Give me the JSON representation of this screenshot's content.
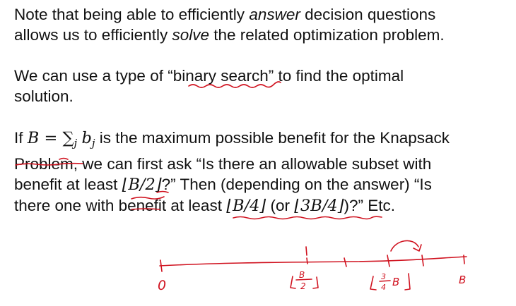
{
  "paragraph1": {
    "line1_a": "Note that being able to efficiently ",
    "line1_em": "answer",
    "line1_b": " decision questions",
    "line2_a": "allows us to efficiently ",
    "line2_em": "solve",
    "line2_b": " the related optimization problem."
  },
  "paragraph2": {
    "line1_a": "We can use a type of “",
    "line1_highlight": "binary search",
    "line1_b": "” to find the optimal",
    "line2": "solution."
  },
  "paragraph3": {
    "if": "If ",
    "B": "B",
    "eq": " = ",
    "sum": "∑",
    "sum_sub": "j",
    "b": "b",
    "b_sub": "j",
    "line1_rest": " is the maximum possible benefit for the Knapsack",
    "problem": "Problem",
    "line2_rest": ", we can first ask “Is there an allowable subset with",
    "line3_a": "benefit at least ",
    "floor_half": "⌊B/2⌋",
    "line3_b": "?” Then (depending on the answer) “Is",
    "line4_a": "there one with ",
    "benefit": "benefit",
    "line4_b": " at least ",
    "floor_quarter": "⌊B/4⌋",
    "line4_c": " (or ",
    "floor_three_quarter": "⌊3B/4⌋",
    "line4_d": ")?” Etc."
  },
  "annotations": {
    "ink_color": "#d0121f",
    "zero_label": "0",
    "half_num": "B",
    "half_den": "2",
    "three_quarter_num": "3",
    "three_quarter_den": "4",
    "three_quarter_var": "B",
    "end_label": "B"
  }
}
